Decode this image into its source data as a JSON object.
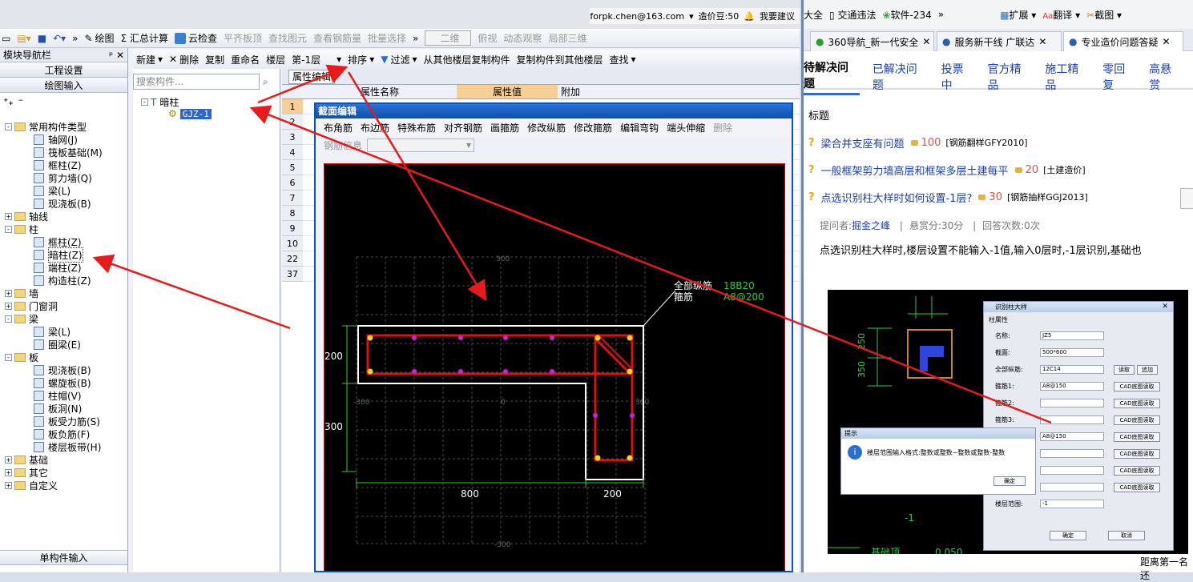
{
  "app": {
    "account": "forpk.chen@163.com",
    "price_beans": "造价豆:50",
    "feedback": "我要建议",
    "toolbar1": [
      "绘图",
      "Σ 汇总计算",
      "云检查",
      "平齐板顶",
      "查找图元",
      "查看钢筋量",
      "批量选择",
      "二维",
      "俯视",
      "动态观察",
      "局部三维"
    ],
    "toolbar2": [
      "新建",
      "删除",
      "复制",
      "重命名",
      "楼层",
      "第-1层",
      "排序",
      "过滤",
      "从其他楼层复制构件",
      "复制构件到其他楼层",
      "查找"
    ],
    "nav_title": "模块导航栏",
    "nav_btn1": "工程设置",
    "nav_btn2": "绘图输入",
    "nav_bottom": "单构件输入",
    "search_placeholder": "搜索构件...",
    "tree": [
      {
        "label": "常用构件类型",
        "level": 0,
        "expand": "-"
      },
      {
        "label": "轴网(J)",
        "level": 1
      },
      {
        "label": "筏板基础(M)",
        "level": 1
      },
      {
        "label": "框柱(Z)",
        "level": 1
      },
      {
        "label": "剪力墙(Q)",
        "level": 1
      },
      {
        "label": "梁(L)",
        "level": 1
      },
      {
        "label": "现浇板(B)",
        "level": 1
      },
      {
        "label": "轴线",
        "level": 0,
        "expand": "+"
      },
      {
        "label": "柱",
        "level": 0,
        "expand": "-"
      },
      {
        "label": "框柱(Z)",
        "level": 1
      },
      {
        "label": "暗柱(Z)",
        "level": 1
      },
      {
        "label": "端柱(Z)",
        "level": 1
      },
      {
        "label": "构造柱(Z)",
        "level": 1
      },
      {
        "label": "墙",
        "level": 0,
        "expand": "+"
      },
      {
        "label": "门窗洞",
        "level": 0,
        "expand": "+"
      },
      {
        "label": "梁",
        "level": 0,
        "expand": "-"
      },
      {
        "label": "梁(L)",
        "level": 1
      },
      {
        "label": "圈梁(E)",
        "level": 1
      },
      {
        "label": "板",
        "level": 0,
        "expand": "-"
      },
      {
        "label": "现浇板(B)",
        "level": 1
      },
      {
        "label": "螺旋板(B)",
        "level": 1
      },
      {
        "label": "柱帽(V)",
        "level": 1
      },
      {
        "label": "板洞(N)",
        "level": 1
      },
      {
        "label": "板受力筋(S)",
        "level": 1
      },
      {
        "label": "板负筋(F)",
        "level": 1
      },
      {
        "label": "楼层板带(H)",
        "level": 1
      },
      {
        "label": "基础",
        "level": 0,
        "expand": "+"
      },
      {
        "label": "其它",
        "level": 0,
        "expand": "+"
      },
      {
        "label": "自定义",
        "level": 0,
        "expand": "+"
      }
    ],
    "comp_root": "暗柱",
    "comp_item": "GJZ-1",
    "attr_tab": "属性编辑",
    "attr_headers": [
      "属性名称",
      "属性值",
      "附加"
    ],
    "row_numbers": [
      "1",
      "2",
      "3",
      "4",
      "5",
      "6",
      "7",
      "8",
      "9",
      "10",
      "22",
      "37"
    ]
  },
  "dialog": {
    "title": "截面编辑",
    "menu": [
      "布角筋",
      "布边筋",
      "特殊布筋",
      "对齐钢筋",
      "画箍筋",
      "修改纵筋",
      "修改箍筋",
      "编辑弯钩",
      "端头伸缩",
      "删除"
    ],
    "rebar_info_label": "钢筋信息",
    "canvas": {
      "label_all": "全部纵筋",
      "label_all_val": "18B20",
      "label_stirrup": "箍筋",
      "label_stirrup_val": "A8@200",
      "dim_200_left": "200",
      "dim_300_left": "300",
      "dim_800": "800",
      "dim_200_bottom": "200",
      "tick_top": "300",
      "tick_bottom": "-300",
      "tick_left": "-300",
      "tick_center": "0",
      "tick_right": "300"
    }
  },
  "browser": {
    "bookmarks": [
      "大全",
      "交通违法",
      "软件-234",
      "»",
      "扩展",
      "翻译",
      "截图"
    ],
    "tabs": [
      "360导航_新一代安全",
      "服务新干线 广联达",
      "专业造价问题答疑"
    ],
    "nav": [
      "待解决问题",
      "已解决问题",
      "投票中",
      "官方精品",
      "施工精品",
      "零回复",
      "高悬赏"
    ],
    "col_title": "标题",
    "questions": [
      {
        "title": "梁合并支座有问题",
        "score": "100",
        "tag": "[钢筋翻样GFY2010]"
      },
      {
        "title": "一般框架剪力墙高层和框架多层土建每平",
        "score": "20",
        "tag": "[土建造价]"
      },
      {
        "title": "点选识别柱大样时如何设置-1层?",
        "score": "30",
        "tag": "[钢筋抽样GGJ2013]"
      }
    ],
    "meta_asker": "提问者:",
    "meta_user": "掘金之峰",
    "meta_reward": "悬赏分:30分",
    "meta_answers": "回答次数:0次",
    "body": "点选识别柱大样时,楼层设置不能输入-1值,输入0层时,-1层识别,基础也",
    "bottom_right": "距离第一名还",
    "shot": {
      "dlg_title": "识别柱大样",
      "section": "柱属性",
      "fields": [
        {
          "label": "名称:",
          "value": "JZ5"
        },
        {
          "label": "截面:",
          "value": "500*600"
        },
        {
          "label": "全部纵筋:",
          "value": "12C14"
        },
        {
          "label": "箍筋1:",
          "value": "A8@150"
        },
        {
          "label": "箍筋2:",
          "value": ""
        },
        {
          "label": "箍筋3:",
          "value": ""
        },
        {
          "label": "拉筋1:",
          "value": "A8@150"
        },
        {
          "label": "",
          "value": ""
        },
        {
          "label": "",
          "value": ""
        },
        {
          "label": "",
          "value": ""
        },
        {
          "label": "楼层范围:",
          "value": "-1"
        }
      ],
      "btn_read": "读取",
      "btn_add": "追加",
      "btn_cad": "CAD底图读取",
      "ok": "确定",
      "cancel": "取消",
      "tip_title": "提示",
      "tip_msg": "楼层范围输入格式:整数或整数~整数或整数-整数",
      "tip_ok": "确定",
      "cad_250": "250",
      "cad_350": "350",
      "cad_neg1": "-1",
      "cad_bottom": "基础顶",
      "cad_num": "0.050"
    }
  }
}
